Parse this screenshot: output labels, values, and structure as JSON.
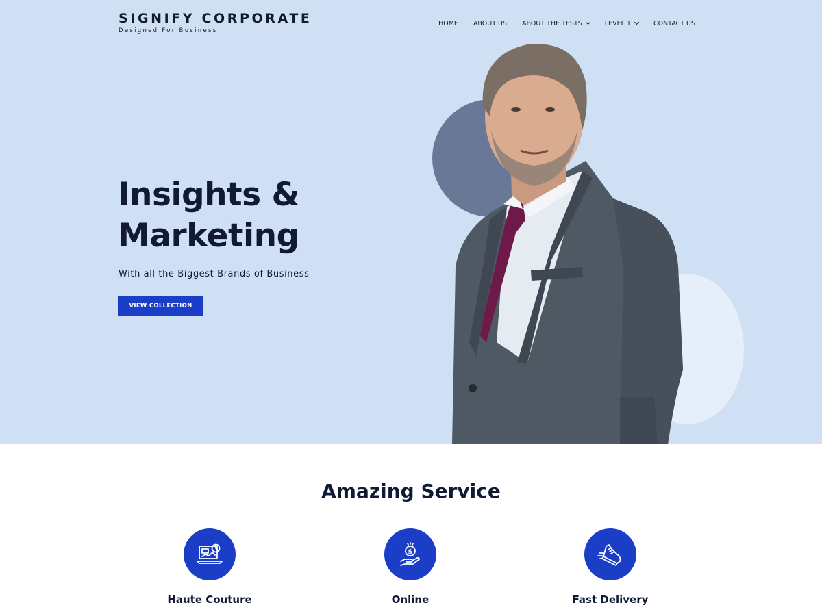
{
  "header": {
    "brand_title": "SIGNIFY CORPORATE",
    "brand_tagline": "Designed For Business"
  },
  "nav": {
    "items": [
      {
        "label": "HOME",
        "dropdown": false
      },
      {
        "label": "ABOUT US",
        "dropdown": false
      },
      {
        "label": "ABOUT THE TESTS",
        "dropdown": true
      },
      {
        "label": "LEVEL 1",
        "dropdown": true
      },
      {
        "label": "CONTACT US",
        "dropdown": false
      }
    ]
  },
  "hero": {
    "headline_line1": "Insights &",
    "headline_line2": "Marketing",
    "subheadline": "With all the Biggest Brands of Business",
    "cta_label": "VIEW COLLECTION",
    "image": "businessman-in-grey-suit-photo"
  },
  "services": {
    "title": "Amazing Service",
    "items": [
      {
        "label": "Haute Couture",
        "icon": "analytics-laptop-icon"
      },
      {
        "label": "Online",
        "icon": "money-hand-icon"
      },
      {
        "label": "Fast Delivery",
        "icon": "running-shoe-icon"
      }
    ]
  },
  "colors": {
    "hero_bg": "#cfe0f5",
    "accent": "#1a3ec6",
    "heading": "#111a35",
    "circle_dark": "#687896",
    "circle_light": "#e6eefa"
  }
}
